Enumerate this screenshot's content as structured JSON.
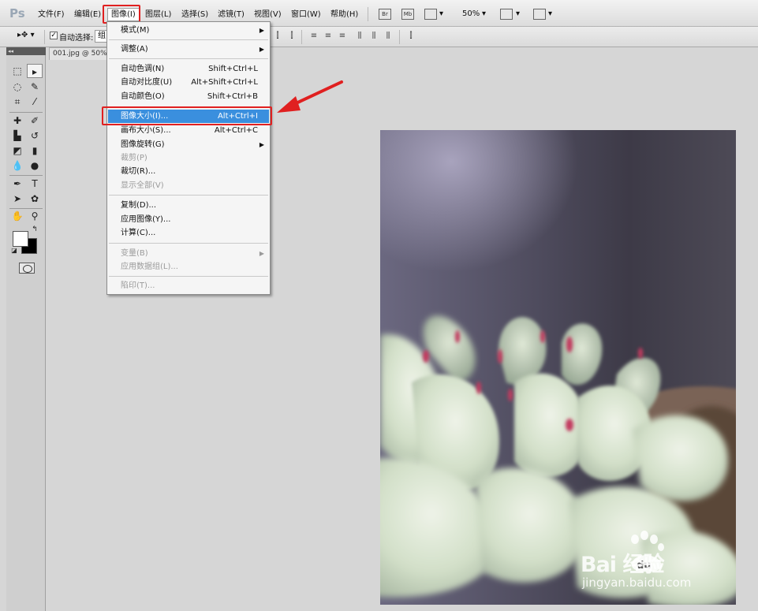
{
  "menubar": {
    "logo": "Ps",
    "items": [
      "文件(F)",
      "编辑(E)",
      "图像(I)",
      "图层(L)",
      "选择(S)",
      "滤镜(T)",
      "视图(V)",
      "窗口(W)",
      "帮助(H)"
    ],
    "bridge_icon": "Br",
    "minibridge_icon": "Mb",
    "zoom": "50%"
  },
  "options": {
    "auto_select_label": "自动选择:",
    "auto_select_value": "组"
  },
  "document": {
    "tab_title": "001.jpg @ 50%"
  },
  "image_menu": {
    "items": [
      {
        "label": "模式(M)",
        "shortcut": "",
        "submenu": true,
        "disabled": false
      },
      {
        "label": "调整(A)",
        "shortcut": "",
        "submenu": true,
        "disabled": false
      },
      {
        "label": "自动色调(N)",
        "shortcut": "Shift+Ctrl+L",
        "submenu": false,
        "disabled": false
      },
      {
        "label": "自动对比度(U)",
        "shortcut": "Alt+Shift+Ctrl+L",
        "submenu": false,
        "disabled": false
      },
      {
        "label": "自动颜色(O)",
        "shortcut": "Shift+Ctrl+B",
        "submenu": false,
        "disabled": false
      },
      {
        "label": "图像大小(I)...",
        "shortcut": "Alt+Ctrl+I",
        "submenu": false,
        "disabled": false,
        "highlighted": true
      },
      {
        "label": "画布大小(S)...",
        "shortcut": "Alt+Ctrl+C",
        "submenu": false,
        "disabled": false
      },
      {
        "label": "图像旋转(G)",
        "shortcut": "",
        "submenu": true,
        "disabled": false
      },
      {
        "label": "裁剪(P)",
        "shortcut": "",
        "submenu": false,
        "disabled": true
      },
      {
        "label": "裁切(R)...",
        "shortcut": "",
        "submenu": false,
        "disabled": false
      },
      {
        "label": "显示全部(V)",
        "shortcut": "",
        "submenu": false,
        "disabled": true
      },
      {
        "label": "复制(D)...",
        "shortcut": "",
        "submenu": false,
        "disabled": false
      },
      {
        "label": "应用图像(Y)...",
        "shortcut": "",
        "submenu": false,
        "disabled": false
      },
      {
        "label": "计算(C)...",
        "shortcut": "",
        "submenu": false,
        "disabled": false
      },
      {
        "label": "变量(B)",
        "shortcut": "",
        "submenu": true,
        "disabled": true
      },
      {
        "label": "应用数据组(L)...",
        "shortcut": "",
        "submenu": false,
        "disabled": true
      },
      {
        "label": "陷印(T)...",
        "shortcut": "",
        "submenu": false,
        "disabled": true
      }
    ]
  },
  "watermark": {
    "brand": "Bai  经验",
    "brand_paw_text": "du",
    "url": "jingyan.baidu.com"
  },
  "colors": {
    "highlight": "#3a8fde",
    "annotation_red": "#e02020"
  }
}
